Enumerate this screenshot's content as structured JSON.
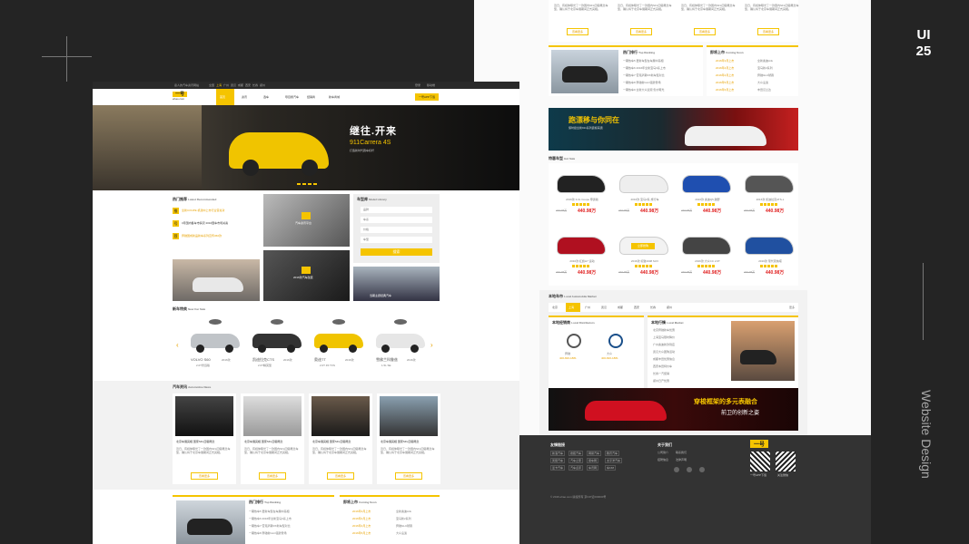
{
  "deco": {
    "ui": "UI",
    "num": "25",
    "side_title": "Website Design"
  },
  "topbar": {
    "left": "嘉人的汽车资讯网站",
    "cities": [
      "全国",
      "上海",
      "广州",
      "武汉",
      "成都",
      "西安",
      "长春",
      "郑州"
    ],
    "right": [
      "登录",
      "移动端"
    ]
  },
  "logo": {
    "top": "一号",
    "bottom": "ehao.com"
  },
  "nav": {
    "items": [
      "首页",
      "资讯",
      "选车",
      "导目扬汽车",
      "经销商",
      "新车商城"
    ],
    "cta": "一号APP下载"
  },
  "hero": {
    "title": "继往.开来",
    "subtitle": "911Carrera 4S",
    "tag": "打造新时代跑车标杆"
  },
  "latest": {
    "title": "热门推荐",
    "en": "Latest Recommended",
    "items": [
      {
        "badge": "推",
        "text": "全新COUPE 机建中上市行业营总对"
      },
      {
        "badge": "号",
        "text": "3月国内各车市情况 2016国车市场关案"
      },
      {
        "badge": "荐",
        "text": "奔驰国成新品新车系列宣传360款"
      }
    ],
    "card_text": "汽车资讯平台",
    "card2": "2016款汽车改装",
    "card3": "2016款汽车改装",
    "card4": "当期主题经典汽车"
  },
  "library": {
    "title": "车型库",
    "en": "Model Library",
    "selects": [
      "品牌",
      "车系",
      "价格",
      "车型"
    ],
    "button": "搜索"
  },
  "newcars": {
    "title": "新车特卖",
    "en": "New Car Sale",
    "cars": [
      {
        "name": "VOLVO S60",
        "year": "2016款",
        "sub": "2.0T智远版"
      },
      {
        "name": "凯迪拉克CTS",
        "year": "2016款",
        "sub": "2.0T精英型"
      },
      {
        "name": "奥迪TT",
        "year": "2016款",
        "sub": "2.0T 45 TFSI"
      },
      {
        "name": "雪佛兰科鲁兹",
        "year": "2016款",
        "sub": "1.5L SE"
      }
    ]
  },
  "news": {
    "title": "汽车资讯",
    "en": "Automotive News",
    "items": [
      {
        "headline": "北京车展亮相 国家SFL四驱概念"
      },
      {
        "headline": "北京车展亮相 国家SFL四驱概念"
      },
      {
        "headline": "北京车展亮相 国家SFL四驱概念"
      },
      {
        "headline": "北京车展亮相 国家SFL四驱概念"
      }
    ],
    "body": "近日，有媒体曝光了一款国内SFL四驱概念车型，确认将于北京车展期间正式亮相。",
    "more": "查看更多"
  },
  "ranking": {
    "title": "热门排行",
    "en": "Top Ranking",
    "items": [
      "一期热车5 更新车型在车展中亮相",
      "一期热车6 2016年全新宝马3系上市",
      "一期热车7 雷克萨斯RX新车型对比",
      "一期热车8 奔驰新GLC强势登场",
      "一期热车9 全新大众途观 售价曝光"
    ]
  },
  "coming": {
    "title": "即将上市",
    "en": "Coming Soon",
    "items": [
      "2016年3月上市",
      "2016年4月上市",
      "2016年4月上市",
      "2016年5月上市",
      "2016年6月上市"
    ],
    "names": [
      "全新奥迪A4L",
      "宝马新2系列",
      "奔驰GLC轿跑",
      "大众凌渡",
      "丰田汉兰达"
    ]
  },
  "banner1": {
    "title": "跑漂移与你同在",
    "sub": "保时捷全新911系列震撼来袭"
  },
  "hot": {
    "title": "特惠车型",
    "en": "Hot Sale",
    "cars": [
      {
        "name": "2016款 3.0L Coupe 尊贵版",
        "price": "440.98万"
      },
      {
        "name": "2016款 宝马2系 旅行车",
        "price": "440.98万"
      },
      {
        "name": "2016款 奥迪Q5 越野",
        "price": "440.98万"
      },
      {
        "name": "2016款 凯迪拉克ATS-L",
        "price": "440.98万"
      },
      {
        "name": "2016款 红旗H7 运动",
        "price": "440.98万"
      },
      {
        "name": "2016款 标致4008 SUV",
        "price": "440.98万"
      },
      {
        "name": "2016款 大众CC 2.0T",
        "price": "440.98万"
      },
      {
        "name": "2016款 现代索纳塔",
        "price": "440.98万"
      }
    ],
    "popup": "立即抢购",
    "old": "440.98万"
  },
  "local": {
    "title": "本地车市",
    "en": "Local Automobile Market",
    "tabs": [
      "北京",
      "上海",
      "广州",
      "武汉",
      "成都",
      "西安",
      "长春",
      "郑州"
    ],
    "more": "更多",
    "dealer_title": "本地经销商",
    "dealer_en": "Local Distributors",
    "dealers": [
      {
        "brand": "奔驰",
        "phone": "400-820-1881"
      },
      {
        "brand": "大众",
        "phone": "400-820-1881"
      }
    ],
    "market_title": "本地行情",
    "market_en": "Local Market",
    "items": [
      "北京奔驰新车优惠",
      "上海宝马限时降价",
      "广州奥迪新款到店",
      "武汉大众团购活动",
      "成都丰田优惠信息",
      "西安本田特价车",
      "长春一汽促销",
      "郑州日产优惠"
    ]
  },
  "banner2": {
    "title": "穿梭框架的多元表融合",
    "sub": "前卫的创新之姿"
  },
  "footer": {
    "friends_title": "友情链接",
    "links": [
      "新浪汽车",
      "搜狐汽车",
      "网易汽车",
      "腾讯汽车",
      "凤凰汽车",
      "汽车之家",
      "易车网",
      "太平洋汽车",
      "爱卡汽车",
      "汽车点评",
      "车讯网",
      "车168"
    ],
    "about_title": "关于我们",
    "about": [
      "公司简介",
      "联系我们",
      "招聘信息",
      "法律声明"
    ],
    "qr_title": "一号APP下载",
    "qr2": "关注微信",
    "copyright": "© 2016 ehao.com 版权所有 京ICP证000000号"
  },
  "colors": {
    "accent": "#f5c400",
    "dark": "#242424"
  }
}
